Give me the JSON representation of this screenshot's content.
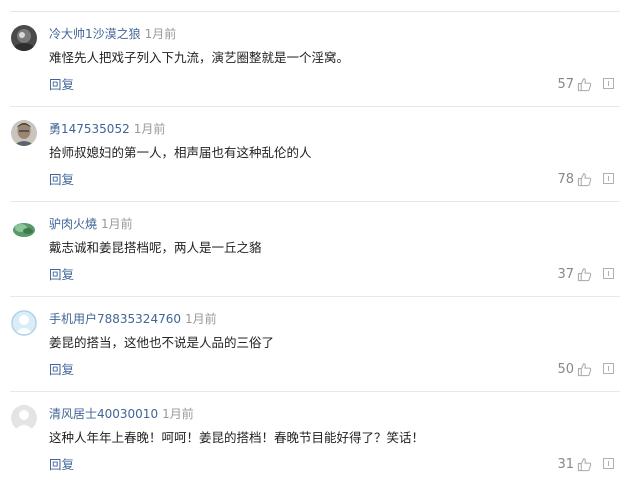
{
  "comments": [
    {
      "username": "冷大帅1沙漠之狼",
      "time": "1月前",
      "text": "难怪先人把戏子列入下九流，演艺圈整就是一个淫窝。",
      "reply_label": "回复",
      "likes": "57",
      "avatar": "gray-circle-avatar"
    },
    {
      "username": "勇147535052",
      "time": "1月前",
      "text": "拾师叔媳妇的第一人，相声届也有这种乱伦的人",
      "reply_label": "回复",
      "likes": "78",
      "avatar": "portrait-avatar"
    },
    {
      "username": "驴肉火燒",
      "time": "1月前",
      "text": "戴志诚和姜昆搭档呢，两人是一丘之貉",
      "reply_label": "回复",
      "likes": "37",
      "avatar": "jade-cabbage-avatar"
    },
    {
      "username": "手机用户78835324760",
      "time": "1月前",
      "text": "姜昆的搭当，这他也不说是人品的三俗了",
      "reply_label": "回复",
      "likes": "50",
      "avatar": "default-user-avatar"
    },
    {
      "username": "清风居士40030010",
      "time": "1月前",
      "text": "这种人年年上春晚！呵呵！姜昆的搭档！春晚节目能好得了？笑话！",
      "reply_label": "回复",
      "likes": "31",
      "avatar": "landscape-avatar"
    }
  ],
  "colors": {
    "username": "#406599",
    "time": "#999999",
    "text": "#222222",
    "reply": "#406599",
    "like_count": "#888888",
    "divider": "#e8e8e8"
  }
}
